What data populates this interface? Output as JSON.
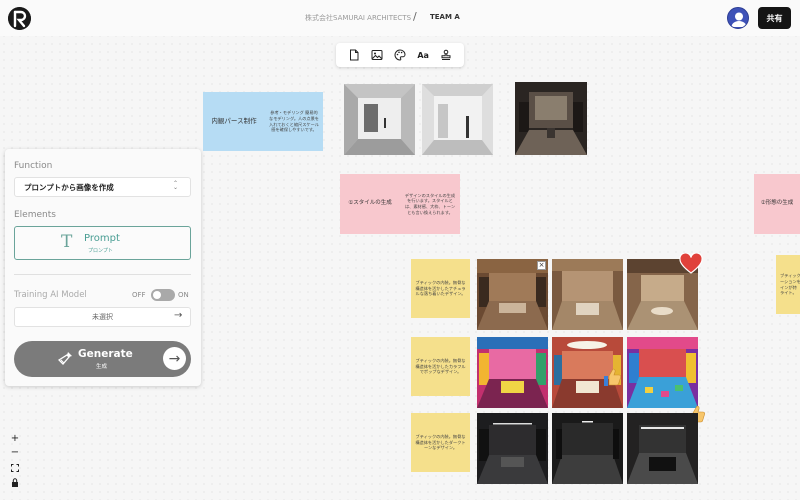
{
  "header": {
    "company": "株式会社SAMURAI ARCHITECTS",
    "separator": "/",
    "team": "TEAM A",
    "share_label": "共有"
  },
  "toolbar": {
    "icons": [
      "file-icon",
      "image-icon",
      "palette-icon",
      "text-style-icon",
      "stamp-icon"
    ],
    "text_icon_label": "Aa"
  },
  "panel": {
    "function_label": "Function",
    "function_value": "プロンプトから画像を作成",
    "elements_label": "Elements",
    "prompt_label": "Prompt",
    "prompt_sub": "プロンプト",
    "training_label": "Training AI Model",
    "toggle_off": "OFF",
    "toggle_on": "ON",
    "model_value": "未選択",
    "generate_label": "Generate",
    "generate_sub": "生成"
  },
  "board": {
    "blue_title": "内観パース制作",
    "blue_desc": "参考・モデリング 簡易的なモデリング。人の点景を入れておくと縮尺スケール感を確保しやすいです。",
    "pink_title": "①スタイルの生成",
    "pink_desc": "デザインのスタイルの生成を行います。スタイルとは、素材感、大枠、トーンとも言い換えられます。",
    "pink_right_title": "②形態の生成",
    "yellow_notes": [
      "ブティックの内装。無骨な構造体を活かしたナチュラルな落ち着いたデザイン。",
      "ブティックの内装。無骨な構造体を活かしたカラフルでポップなデザイン。",
      "ブティックの内装。無骨な構造体を活かしたダークトーンなデザイン。"
    ],
    "yellow_right": "ブティック\nーションを\nインが特\nライト。"
  },
  "zoom": {
    "plus": "+",
    "minus": "−"
  },
  "colors": {
    "prompt_accent": "#6aa49a",
    "note_blue": "#b6dcf4",
    "note_pink": "#f8c8ce",
    "note_yellow": "#f5e08c",
    "heart": "#e0413a",
    "thumb": "#3b7fd8",
    "generate_btn": "#7b7b7b"
  }
}
